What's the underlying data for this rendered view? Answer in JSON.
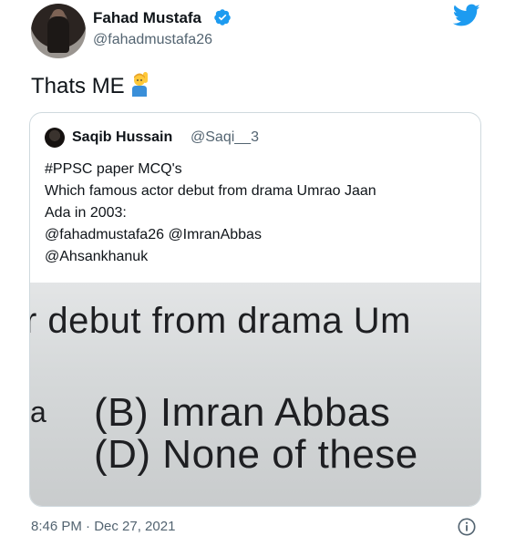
{
  "author": {
    "display_name": "Fahad Mustafa",
    "handle": "@fahadmustafa26"
  },
  "tweet": {
    "text": "Thats ME",
    "emoji": "person-raising-hand-emoji"
  },
  "quoted_tweet": {
    "display_name": "Saqib Hussain",
    "handle": "@Saqi__3",
    "lines": [
      "#PPSC paper MCQ's",
      "Which famous actor debut from drama Umrao Jaan",
      "Ada in 2003:",
      "@fahadmustafa26  @ImranAbbas",
      "@Ahsankhanuk"
    ],
    "photo_text": {
      "line1": "r debut from drama Um",
      "fragment": "a",
      "option_b": "(B)  Imran Abbas",
      "option_d": "(D)  None of these"
    }
  },
  "timestamp": "8:46 PM · Dec 27, 2021",
  "icons": {
    "verified": "verified-badge-icon",
    "twitter": "twitter-bird-icon",
    "info": "info-icon"
  },
  "colors": {
    "twitter_blue": "#1d9bf0",
    "secondary_text": "#536471",
    "border": "#cfd9de"
  }
}
